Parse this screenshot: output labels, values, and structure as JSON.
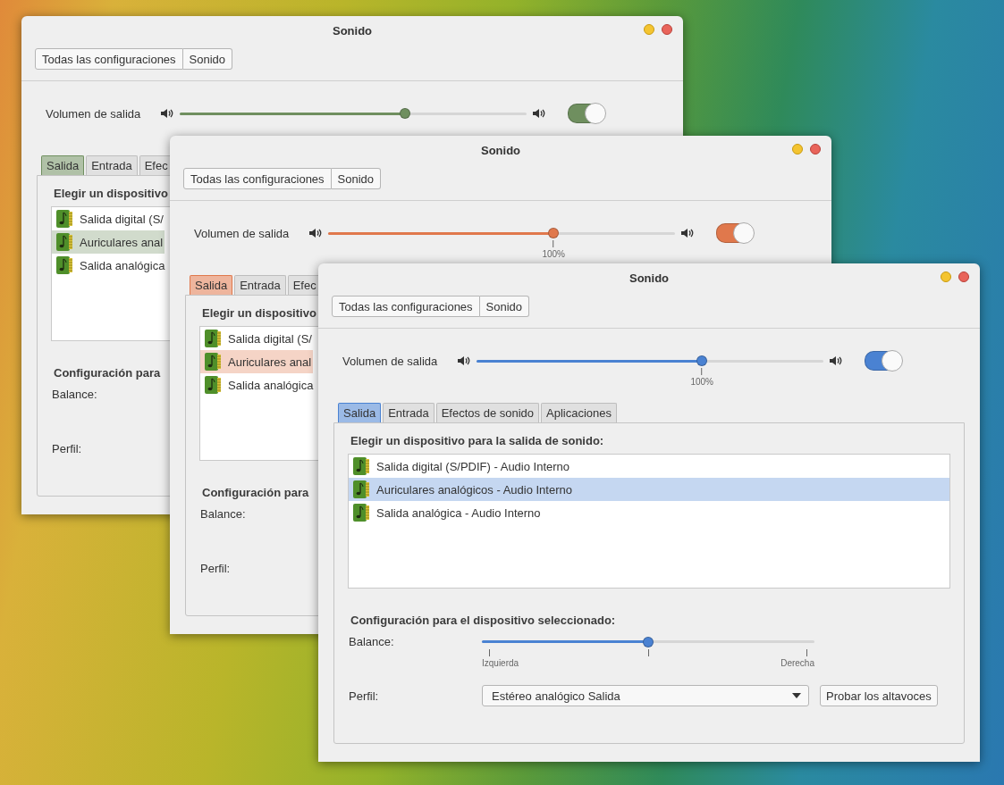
{
  "windows": [
    {
      "title": "Sonido",
      "color": "#6f8f5f",
      "breadcrumb": [
        {
          "label": "Todas las configuraciones"
        },
        {
          "label": "Sonido"
        }
      ],
      "volume": {
        "label": "Volumen de salida",
        "level": 0.65,
        "on": true
      },
      "tabs": [
        {
          "label": "Salida",
          "selected": true
        },
        {
          "label": "Entrada",
          "selected": false
        },
        {
          "label": "Efec",
          "selected": false
        }
      ],
      "device_heading": "Elegir un dispositivo",
      "devices": [
        {
          "name": "Salida digital (S/",
          "selected": false
        },
        {
          "name": "Auriculares anal",
          "selected": true
        },
        {
          "name": "Salida analógica",
          "selected": false
        }
      ],
      "settings_heading": "Configuración para",
      "balance": {
        "label": "Balance:"
      },
      "profile": {
        "label": "Perfil:"
      }
    },
    {
      "title": "Sonido",
      "color": "#e0784c",
      "breadcrumb": [
        {
          "label": "Todas las configuraciones"
        },
        {
          "label": "Sonido"
        }
      ],
      "volume": {
        "label": "Volumen de salida",
        "level": 0.65,
        "on": true,
        "reading": "100%"
      },
      "tabs": [
        {
          "label": "Salida",
          "selected": true
        },
        {
          "label": "Entrada",
          "selected": false
        },
        {
          "label": "Efec",
          "selected": false
        }
      ],
      "device_heading": "Elegir un dispositivo",
      "devices": [
        {
          "name": "Salida digital (S/",
          "selected": false
        },
        {
          "name": "Auriculares anal",
          "selected": true
        },
        {
          "name": "Salida analógica",
          "selected": false
        }
      ],
      "settings_heading": "Configuración para",
      "balance": {
        "label": "Balance:"
      },
      "profile": {
        "label": "Perfil:"
      }
    },
    {
      "title": "Sonido",
      "color": "#4a82d2",
      "breadcrumb": [
        {
          "label": "Todas las configuraciones"
        },
        {
          "label": "Sonido"
        }
      ],
      "volume": {
        "label": "Volumen de salida",
        "level": 0.65,
        "on": true,
        "reading": "100%"
      },
      "tabs": [
        {
          "label": "Salida",
          "selected": true
        },
        {
          "label": "Entrada",
          "selected": false
        },
        {
          "label": "Efectos de sonido",
          "selected": false
        },
        {
          "label": "Aplicaciones",
          "selected": false
        }
      ],
      "device_heading": "Elegir un dispositivo para la salida de sonido:",
      "devices": [
        {
          "name": "Salida digital (S/PDIF) - Audio Interno",
          "selected": false
        },
        {
          "name": "Auriculares analógicos - Audio Interno",
          "selected": true
        },
        {
          "name": "Salida analógica - Audio Interno",
          "selected": false
        }
      ],
      "settings_heading": "Configuración para el dispositivo seleccionado:",
      "balance": {
        "label": "Balance:",
        "level": 0.5,
        "left": "Izquierda",
        "right": "Derecha"
      },
      "profile": {
        "label": "Perfil:",
        "value": "Estéreo analógico Salida",
        "button": "Probar los altavoces"
      }
    }
  ]
}
